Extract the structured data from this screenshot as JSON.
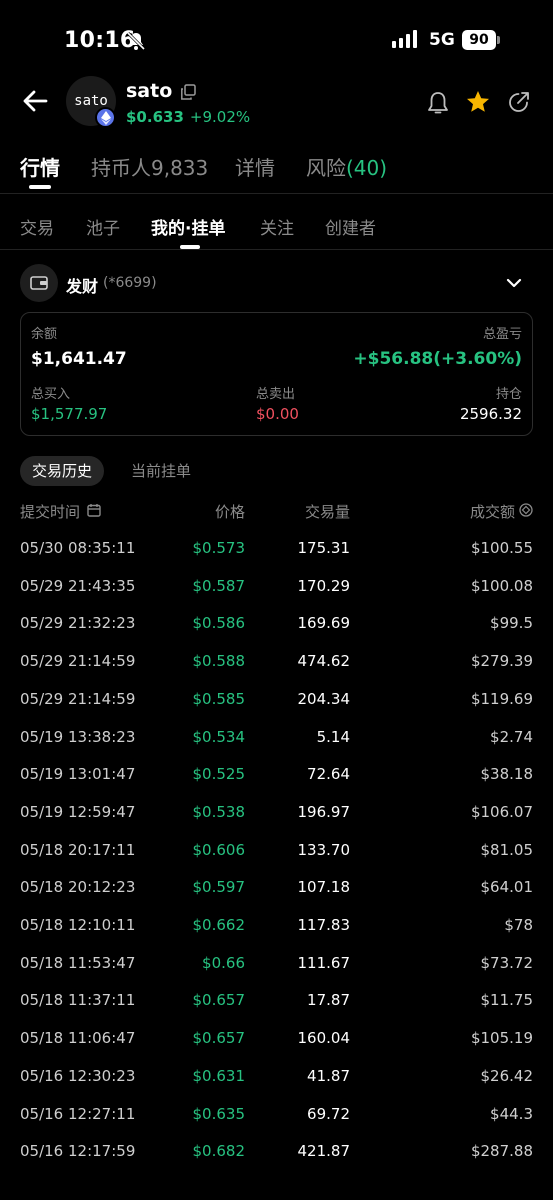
{
  "status_bar": {
    "time": "10:16",
    "network": "5G",
    "battery": "90",
    "icons": [
      "bell-off-icon",
      "signal-icon"
    ]
  },
  "header": {
    "logo_text": "sato",
    "token_name": "sato",
    "price": "$0.633",
    "change": "+9.02%",
    "icons": [
      "back-arrow-icon",
      "copy-icon",
      "bell-icon",
      "star-icon",
      "share-icon",
      "ethereum-icon"
    ],
    "accent": "#27c281",
    "star_color": "#f7b500"
  },
  "main_tabs": [
    {
      "label": "行情",
      "active": true
    },
    {
      "label": "持币人9,833",
      "active": false
    },
    {
      "label": "详情",
      "active": false
    },
    {
      "label": "风险",
      "count": "(40)",
      "active": false
    }
  ],
  "sub_tabs": [
    {
      "label": "交易",
      "active": false
    },
    {
      "label": "池子",
      "active": false
    },
    {
      "label": "我的·挂单",
      "active": true
    },
    {
      "label": "关注",
      "active": false
    },
    {
      "label": "创建者",
      "active": false
    }
  ],
  "wallet": {
    "name": "发财",
    "suffix": "(*6699)",
    "icons": [
      "wallet-icon",
      "chevron-down-icon"
    ]
  },
  "summary": {
    "balance_label": "余额",
    "balance": "$1,641.47",
    "pnl_label": "总盈亏",
    "pnl": "+$56.88(+3.60%)",
    "bought_label": "总买入",
    "bought": "$1,577.97",
    "sold_label": "总卖出",
    "sold": "$0.00",
    "holding_label": "持仓",
    "holding": "2596.32",
    "loss_color": "#f0505f"
  },
  "history_tabs": [
    {
      "label": "交易历史",
      "active": true
    },
    {
      "label": "当前挂单",
      "active": false
    }
  ],
  "table": {
    "headers": {
      "time": "提交时间",
      "price": "价格",
      "volume": "交易量",
      "amount": "成交额"
    },
    "icons": [
      "calendar-icon",
      "currency-toggle-icon"
    ],
    "rows": [
      {
        "time": "05/30 08:35:11",
        "price": "$0.573",
        "volume": "175.31",
        "amount": "$100.55"
      },
      {
        "time": "05/29 21:43:35",
        "price": "$0.587",
        "volume": "170.29",
        "amount": "$100.08"
      },
      {
        "time": "05/29 21:32:23",
        "price": "$0.586",
        "volume": "169.69",
        "amount": "$99.5"
      },
      {
        "time": "05/29 21:14:59",
        "price": "$0.588",
        "volume": "474.62",
        "amount": "$279.39"
      },
      {
        "time": "05/29 21:14:59",
        "price": "$0.585",
        "volume": "204.34",
        "amount": "$119.69"
      },
      {
        "time": "05/19 13:38:23",
        "price": "$0.534",
        "volume": "5.14",
        "amount": "$2.74"
      },
      {
        "time": "05/19 13:01:47",
        "price": "$0.525",
        "volume": "72.64",
        "amount": "$38.18"
      },
      {
        "time": "05/19 12:59:47",
        "price": "$0.538",
        "volume": "196.97",
        "amount": "$106.07"
      },
      {
        "time": "05/18 20:17:11",
        "price": "$0.606",
        "volume": "133.70",
        "amount": "$81.05"
      },
      {
        "time": "05/18 20:12:23",
        "price": "$0.597",
        "volume": "107.18",
        "amount": "$64.01"
      },
      {
        "time": "05/18 12:10:11",
        "price": "$0.662",
        "volume": "117.83",
        "amount": "$78"
      },
      {
        "time": "05/18 11:53:47",
        "price": "$0.66",
        "volume": "111.67",
        "amount": "$73.72"
      },
      {
        "time": "05/18 11:37:11",
        "price": "$0.657",
        "volume": "17.87",
        "amount": "$11.75"
      },
      {
        "time": "05/18 11:06:47",
        "price": "$0.657",
        "volume": "160.04",
        "amount": "$105.19"
      },
      {
        "time": "05/16 12:30:23",
        "price": "$0.631",
        "volume": "41.87",
        "amount": "$26.42"
      },
      {
        "time": "05/16 12:27:11",
        "price": "$0.635",
        "volume": "69.72",
        "amount": "$44.3"
      },
      {
        "time": "05/16 12:17:59",
        "price": "$0.682",
        "volume": "421.87",
        "amount": "$287.88"
      }
    ]
  }
}
